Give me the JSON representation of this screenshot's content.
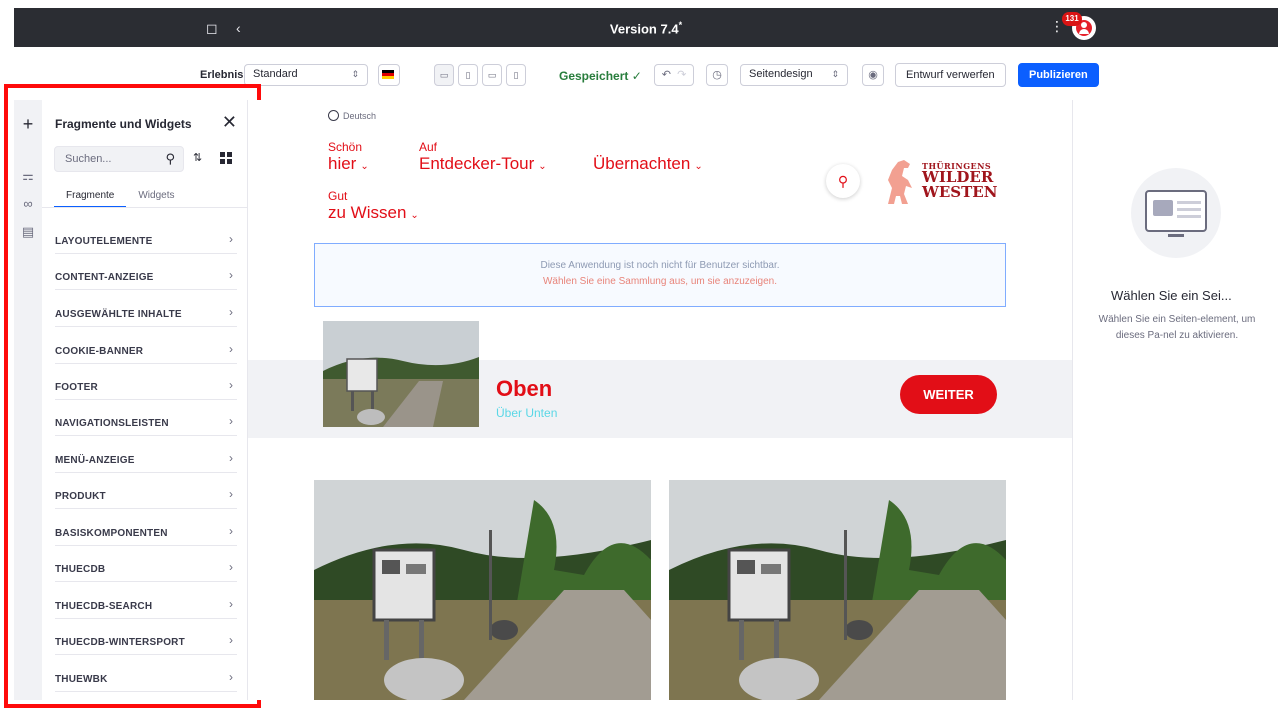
{
  "topbar": {
    "title": "Version 7.4",
    "title_mark": "*",
    "notification_count": "131",
    "colors": {
      "background": "#2b2d33",
      "badge": "#da1414",
      "avatar": "#e5202a"
    }
  },
  "toolbar": {
    "experience_label": "Erlebnis",
    "experience_value": "Standard",
    "saved_label": "Gespeichert",
    "page_design_value": "Seitendesign",
    "discard_label": "Entwurf verwerfen",
    "publish_label": "Publizieren",
    "icons": [
      "sidebar-toggle-icon",
      "back-icon",
      "desktop-icon",
      "tablet-icon",
      "landscape-icon",
      "phone-icon",
      "undo-icon",
      "redo-icon",
      "history-icon",
      "preview-icon"
    ],
    "colors": {
      "saved": "#287d3c",
      "primary": "#0b5fff"
    }
  },
  "sidebar": {
    "title": "Fragmente und Widgets",
    "search_placeholder": "Suchen...",
    "tabs": [
      {
        "label": "Fragmente",
        "active": true
      },
      {
        "label": "Widgets",
        "active": false
      }
    ],
    "categories": [
      "LAYOUTELEMENTE",
      "CONTENT-ANZEIGE",
      "AUSGEWÄHLTE INHALTE",
      "COOKIE-BANNER",
      "FOOTER",
      "NAVIGATIONSLEISTEN",
      "MENÜ-ANZEIGE",
      "PRODUKT",
      "BASISKOMPONENTEN",
      "THUECDB",
      "THUECDB-SEARCH",
      "THUECDB-WINTERSPORT",
      "THUEWBK"
    ],
    "rail_icons": [
      "plus-icon",
      "paint-roller-icon",
      "link-icon",
      "comment-icon"
    ]
  },
  "page": {
    "language": "Deutsch",
    "nav": [
      {
        "small": "Schön",
        "big": "hier"
      },
      {
        "small": "Auf",
        "big": "Entdecker-Tour"
      },
      {
        "small": "",
        "big": "Übernachten"
      },
      {
        "small": "Gut",
        "big": "zu Wissen"
      }
    ],
    "logo": {
      "line1": "THÜRINGENS",
      "line2": "WILDER",
      "line3": "WESTEN"
    },
    "notice": {
      "line1": "Diese Anwendung ist noch nicht für Benutzer sichtbar.",
      "line2": "Wählen Sie eine Sammlung aus, um sie anzuzeigen."
    },
    "banner": {
      "title": "Oben",
      "subtitle": "Über Unten",
      "button": "WEITER"
    },
    "colors": {
      "brand": "#e20e17",
      "subtitle": "#5ad7e6"
    }
  },
  "right_panel": {
    "title": "Wählen Sie ein Sei...",
    "text": "Wählen Sie ein Seiten-element, um dieses Pa-nel zu aktivieren."
  }
}
